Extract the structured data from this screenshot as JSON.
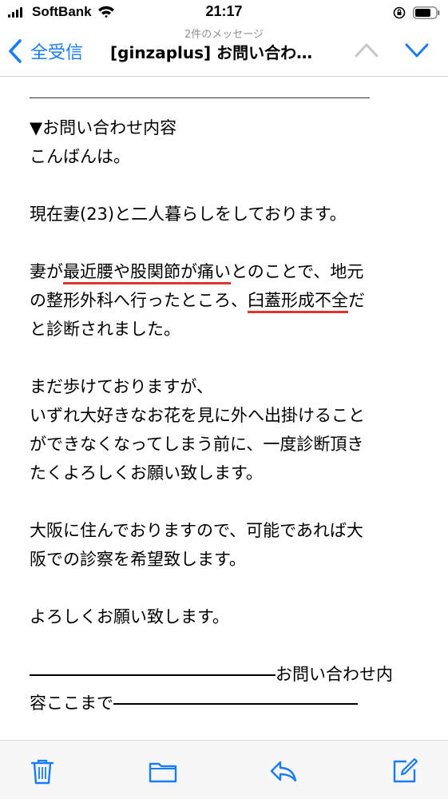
{
  "status_bar": {
    "carrier": "SoftBank",
    "time": "21:17",
    "icons": [
      "signal-icon",
      "wifi-icon",
      "orientation-lock-icon",
      "battery-icon"
    ]
  },
  "nav": {
    "back_label": "全受信",
    "message_count": "2件のメッセージ",
    "subject": "[ginzaplus] お問い合わ…",
    "accent_color": "#1a7cf5"
  },
  "body": {
    "section_heading": "▼お問い合わせ内容",
    "greeting": "こんばんは。",
    "line_family": "現在妻(23)と二人暮らしをしております。",
    "p3": {
      "l1_a": "妻が",
      "l1_highlight": "最近腰や股関節が痛い",
      "l1_b": "とのことで、地元",
      "l2_a": "の整形外科へ行ったところ、",
      "l2_highlight": "臼蓋形成不全",
      "l2_b": "だ",
      "l3": "と診断されました。"
    },
    "p4": {
      "l1": "まだ歩けておりますが、",
      "l2": "いずれ大好きなお花を見に外へ出掛けること",
      "l3": "ができなくなってしまう前に、一度診断頂き",
      "l4": "たくよろしくお願い致します。"
    },
    "p5": {
      "l1": "大阪に住んでおりますので、可能であれば大",
      "l2": "阪での診察を希望致します。"
    },
    "closing": "よろしくお願い致します。",
    "end_marker": {
      "l1_text": "お問い合わせ内",
      "l2_text": "容ここまで"
    },
    "highlight_color": "#e4332f"
  },
  "toolbar": {
    "items": [
      "trash-icon",
      "folder-icon",
      "reply-icon",
      "compose-icon"
    ],
    "icon_color": "#1a7cf5"
  }
}
